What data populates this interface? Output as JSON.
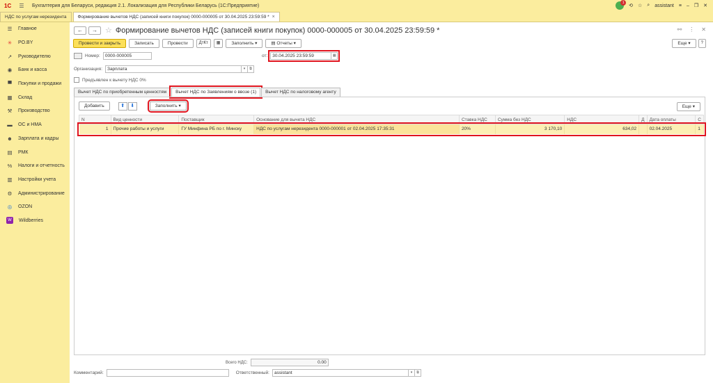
{
  "titlebar": {
    "logo": "1С",
    "app_title": "Бухгалтерия для Беларуси, редакция 2.1. Локализация для Республики Беларусь   (1С:Предприятие)",
    "notif_count": "1",
    "user": "assistant"
  },
  "tabs": [
    {
      "label": "НДС по услугам нерезидента"
    },
    {
      "label": "Формирование вычетов НДС (записей книги покупок) 0000-000005 от 30.04.2025 23:59:59 *"
    }
  ],
  "sidebar": {
    "items": [
      {
        "label": "Главное",
        "icon": "menu-icon"
      },
      {
        "label": "PO.BY",
        "icon": "asterisk-icon"
      },
      {
        "label": "Руководителю",
        "icon": "trend-icon"
      },
      {
        "label": "Банк и касса",
        "icon": "bank-icon"
      },
      {
        "label": "Покупки и продажи",
        "icon": "cart-icon"
      },
      {
        "label": "Склад",
        "icon": "warehouse-icon"
      },
      {
        "label": "Производство",
        "icon": "production-icon"
      },
      {
        "label": "ОС и НМА",
        "icon": "truck-icon"
      },
      {
        "label": "Зарплата и кадры",
        "icon": "people-icon"
      },
      {
        "label": "РМК",
        "icon": "cash-register-icon"
      },
      {
        "label": "Налоги и отчетность",
        "icon": "percent-icon"
      },
      {
        "label": "Настройки учета",
        "icon": "settings-icon"
      },
      {
        "label": "Администрирование",
        "icon": "gear-icon"
      },
      {
        "label": "OZON",
        "icon": "ozon-icon"
      },
      {
        "label": "Wildberries",
        "icon": "wildberries-icon"
      }
    ]
  },
  "header": {
    "title": "Формирование вычетов НДС (записей книги покупок) 0000-000005 от 30.04.2025 23:59:59 *"
  },
  "toolbar": {
    "post_close": "Провести и закрыть",
    "save": "Записать",
    "post": "Провести",
    "fill": "Заполнить",
    "reports": "Отчеты",
    "more": "Еще"
  },
  "form": {
    "number_label": "Номер:",
    "number_value": "0000-000005",
    "date_label": "от:",
    "date_value": "30.04.2025 23:59:59",
    "org_label": "Организация:",
    "org_value": "Зарплата",
    "checkbox_label": "Предъявлен к вычету НДС 0%"
  },
  "doc_tabs": [
    {
      "label": "Вычет НДС по приобретенным ценностям"
    },
    {
      "label": "Вычет НДС по Заявлениям о ввозе (1)"
    },
    {
      "label": "Вычет НДС по налоговому агенту"
    }
  ],
  "panel": {
    "add": "Добавить",
    "fill": "Заполнить",
    "more": "Еще"
  },
  "table": {
    "columns": [
      "N",
      "Вид ценности",
      "Поставщик",
      "Основание для вычета НДС",
      "Ставка НДС",
      "Сумма без НДС",
      "НДС",
      "Д",
      "Дата оплаты",
      "С"
    ],
    "rows": [
      {
        "n": "1",
        "kind": "Прочие работы и услуги",
        "supplier": "ГУ Минфина РБ по г. Минску",
        "basis": "НДС по услугам нерезидента 0000-000001 от 02.04.2025 17:35:31",
        "rate": "20%",
        "amount": "3 170,10",
        "vat": "634,02",
        "d": "",
        "pay_date": "02.04.2025",
        "c": "1"
      }
    ]
  },
  "footer": {
    "total_label": "Всего НДС:",
    "total_value": "0.00",
    "comment_label": "Комментарий:",
    "comment_value": "",
    "responsible_label": "Ответственный:",
    "responsible_value": "assistant"
  },
  "colors": {
    "accent": "#fbed9e",
    "primary_button": "#fce05a",
    "highlight": "#e0141e"
  }
}
